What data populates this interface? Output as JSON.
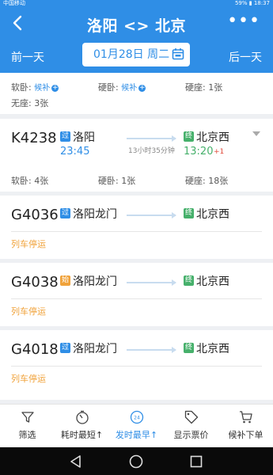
{
  "statusbar": {
    "carrier": "中国移动",
    "right": "59% ▮ 18:37"
  },
  "header": {
    "title": "洛阳 <> 北京",
    "more": "•••",
    "prev_day": "前一天",
    "date": "01月28日 周二",
    "next_day": "后一天"
  },
  "summary": {
    "soft_sleeper": "软卧:",
    "soft_wait": "候补",
    "hard_sleeper": "硬卧:",
    "hard_wait": "候补",
    "hard_seat": "硬座: 1张",
    "no_seat": "无座: 3张"
  },
  "trains": [
    {
      "number": "K4238",
      "from_badge": "过",
      "from": "洛阳",
      "dep": "23:45",
      "duration": "13小时35分钟",
      "to_badge": "终",
      "to": "北京西",
      "arr": "13:20",
      "plus_day": "+1",
      "seat1": "软卧: 4张",
      "seat2": "硬卧: 1张",
      "seat3": "硬座: 18张"
    },
    {
      "number": "G4036",
      "from_badge": "过",
      "from": "洛阳龙门",
      "to_badge": "终",
      "to": "北京西",
      "status": "列车停运"
    },
    {
      "number": "G4038",
      "from_badge": "始",
      "from": "洛阳龙门",
      "to_badge": "终",
      "to": "北京西",
      "status": "列车停运"
    },
    {
      "number": "G4018",
      "from_badge": "过",
      "from": "洛阳龙门",
      "to_badge": "终",
      "to": "北京西",
      "status": "列车停运"
    }
  ],
  "tabs": [
    {
      "label": "筛选",
      "icon": "filter-icon"
    },
    {
      "label": "耗时最短↑",
      "icon": "timer-icon"
    },
    {
      "label": "发时最早↑",
      "icon": "clock-24-icon"
    },
    {
      "label": "显示票价",
      "icon": "price-tag-icon"
    },
    {
      "label": "候补下单",
      "icon": "cart-icon"
    }
  ],
  "colors": {
    "primary": "#2f8ee6",
    "green": "#46b06b",
    "orange": "#f0a23a",
    "red": "#e04a3a"
  }
}
